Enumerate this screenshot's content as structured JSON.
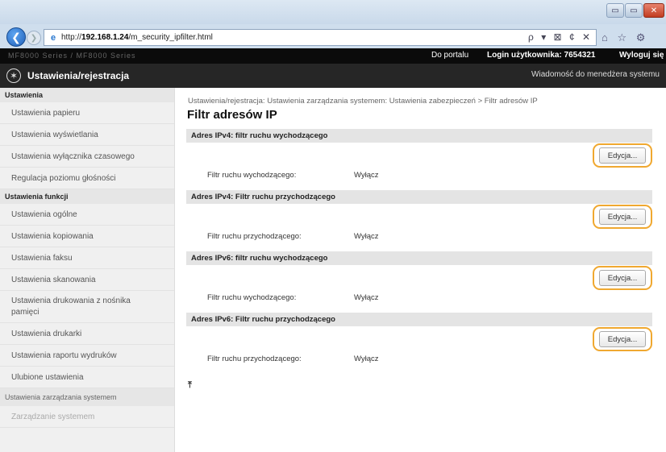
{
  "browser": {
    "url_prefix": "http://",
    "url_host": "192.168.1.24",
    "url_path": "/m_security_ipfilter.html",
    "url_controls": "ρ ▾ ⊠ ¢ ✕",
    "nav_icons": "⌂ ☆ ⚙",
    "window_min": "▭",
    "window_max": "▭",
    "window_close": "✕"
  },
  "userbar": {
    "device_name_blurred": "MF8000 Series / MF8000 Series",
    "portal_link": "Do portalu",
    "login_label": "Login użytkownika:  7654321",
    "logout_link": "Wyloguj się"
  },
  "header": {
    "title": "Ustawienia/rejestracja",
    "admin_message": "Wiadomość do menedżera systemu"
  },
  "sidebar": {
    "section1": "Ustawienia",
    "items1": [
      "Ustawienia papieru",
      "Ustawienia wyświetlania",
      "Ustawienia wyłącznika czasowego",
      "Regulacja poziomu głośności"
    ],
    "section2": "Ustawienia funkcji",
    "items2": [
      "Ustawienia ogólne",
      "Ustawienia kopiowania",
      "Ustawienia faksu",
      "Ustawienia skanowania",
      "Ustawienia drukowania z nośnika pamięci",
      "Ustawienia drukarki",
      "Ustawienia raportu wydruków",
      "Ulubione ustawienia"
    ],
    "section3": "Ustawienia zarządzania systemem",
    "items3": [
      "Zarządzanie systemem"
    ]
  },
  "main": {
    "breadcrumb": "Ustawienia/rejestracja: Ustawienia zarządzania systemem: Ustawienia zabezpieczeń > Filtr adresów IP",
    "page_title": "Filtr adresów IP",
    "sections": [
      {
        "title": "Adres IPv4: filtr ruchu wychodzącego",
        "edit": "Edycja...",
        "label": "Filtr ruchu wychodzącego:",
        "value": "Wyłącz"
      },
      {
        "title": "Adres IPv4: Filtr ruchu przychodzącego",
        "edit": "Edycja...",
        "label": "Filtr ruchu przychodzącego:",
        "value": "Wyłącz"
      },
      {
        "title": "Adres IPv6: filtr ruchu wychodzącego",
        "edit": "Edycja...",
        "label": "Filtr ruchu wychodzącego:",
        "value": "Wyłącz"
      },
      {
        "title": "Adres IPv6: Filtr ruchu przychodzącego",
        "edit": "Edycja...",
        "label": "Filtr ruchu przychodzącego:",
        "value": "Wyłącz"
      }
    ],
    "to_top": "⤒",
    "highlight_color": "#f0a830"
  }
}
